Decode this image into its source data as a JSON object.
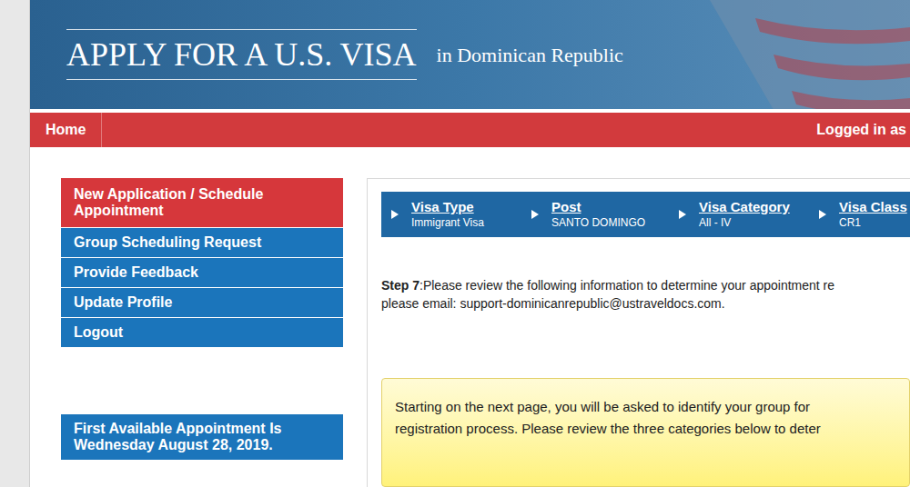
{
  "header": {
    "title": "APPLY FOR A U.S. VISA",
    "subtitle": "in Dominican Republic"
  },
  "nav": {
    "home": "Home",
    "user": "Logged in as"
  },
  "sidebar": {
    "items": [
      {
        "label": "New Application / Schedule Appointment",
        "selected": true
      },
      {
        "label": "Group Scheduling Request",
        "selected": false
      },
      {
        "label": "Provide Feedback",
        "selected": false
      },
      {
        "label": "Update Profile",
        "selected": false
      },
      {
        "label": "Logout",
        "selected": false
      }
    ]
  },
  "first_available": {
    "lines": [
      "First Available Appointment Is",
      "Wednesday August 28, 2019."
    ]
  },
  "steps": [
    {
      "label": "Visa Type",
      "value": "Immigrant Visa"
    },
    {
      "label": "Post",
      "value": "SANTO DOMINGO"
    },
    {
      "label": "Visa Category",
      "value": "All - IV"
    },
    {
      "label": "Visa Class",
      "value": "CR1"
    }
  ],
  "instructions": {
    "prefix": "Step 7",
    "text": ":Please review the following information to determine your appointment re",
    "line2": "please email: support-dominicanrepublic@ustraveldocs.com."
  },
  "notice": {
    "lines": [
      "Starting on the next page, you will be asked to identify your group for",
      "registration process. Please review the three categories below to deter"
    ]
  }
}
